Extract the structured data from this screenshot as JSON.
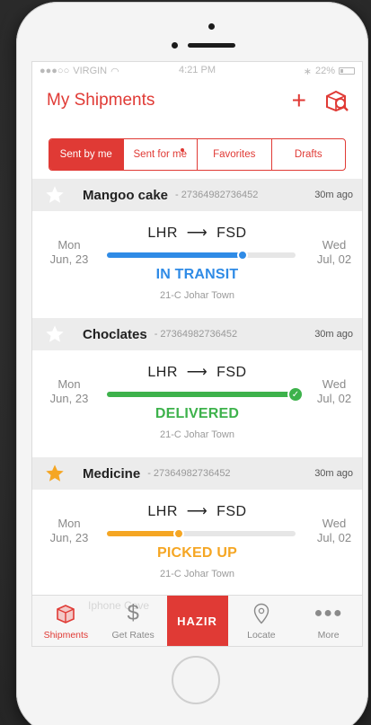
{
  "status_bar": {
    "carrier": "VIRGIN",
    "time": "4:21 PM",
    "battery": "22%"
  },
  "header": {
    "title": "My Shipments",
    "add_icon": "plus-icon",
    "track_icon": "box-search-icon"
  },
  "segments": [
    {
      "label": "Sent by me",
      "active": true
    },
    {
      "label": "Sent for me",
      "active": false,
      "badge": true
    },
    {
      "label": "Favorites",
      "active": false
    },
    {
      "label": "Drafts",
      "active": false
    }
  ],
  "shipments": [
    {
      "name": "Mangoo cake",
      "id": "- 27364982736452",
      "time": "30m ago",
      "starred": false,
      "from_day": "Mon",
      "from_date": "Jun, 23",
      "route_from": "LHR",
      "arrow": "⟶",
      "route_to": "FSD",
      "to_day": "Wed",
      "to_date": "Jul, 02",
      "status": "IN TRANSIT",
      "location": "21-C  Johar Town",
      "color": "#2f8be6",
      "progress": 0.72
    },
    {
      "name": "Choclates",
      "id": "- 27364982736452",
      "time": "30m ago",
      "starred": false,
      "from_day": "Mon",
      "from_date": "Jun, 23",
      "route_from": "LHR",
      "arrow": "⟶",
      "route_to": "FSD",
      "to_day": "Wed",
      "to_date": "Jul, 02",
      "status": "DELIVERED",
      "location": "21-C  Johar Town",
      "color": "#3db24b",
      "progress": 1.0
    },
    {
      "name": "Medicine",
      "id": "- 27364982736452",
      "time": "30m ago",
      "starred": true,
      "from_day": "Mon",
      "from_date": "Jun, 23",
      "route_from": "LHR",
      "arrow": "⟶",
      "route_to": "FSD",
      "to_day": "Wed",
      "to_date": "Jul, 02",
      "status": "PICKED UP",
      "location": "21-C  Johar Town",
      "color": "#f5a623",
      "progress": 0.38
    }
  ],
  "tabbar": {
    "ghost_text": "Iphone Cove",
    "shipments": "Shipments",
    "get_rates": "Get Rates",
    "brand": "HAZIR",
    "locate": "Locate",
    "more": "More"
  },
  "colors": {
    "accent": "#e03a35",
    "star_active": "#f5a623",
    "star_inactive": "#ffffff"
  }
}
